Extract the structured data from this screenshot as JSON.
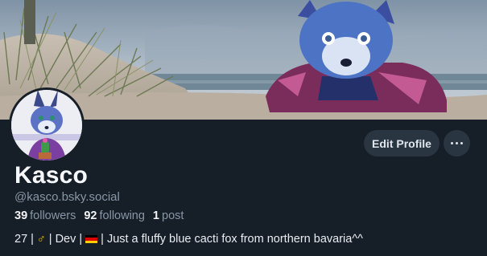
{
  "profile": {
    "display_name": "Kasco",
    "handle": "@kasco.bsky.social",
    "stats": {
      "followers_count": "39",
      "followers_label": "followers",
      "following_count": "92",
      "following_label": "following",
      "posts_count": "1",
      "posts_label": "post"
    },
    "bio": {
      "age": "27",
      "gender_symbol": "♂",
      "role": "Dev",
      "flag_icon": "german-flag-icon",
      "text": "Just a fluffy blue cacti fox from northern bavaria^^",
      "separator": "|"
    }
  },
  "actions": {
    "edit_label": "Edit Profile",
    "more_icon": "ellipsis-icon"
  },
  "colors": {
    "background": "#161e27",
    "button_bg": "#2a3542",
    "muted_text": "#8896a6",
    "gender_accent": "#f5c400",
    "flag_black": "#000000",
    "flag_red": "#dd0000",
    "flag_gold": "#ffce00"
  }
}
